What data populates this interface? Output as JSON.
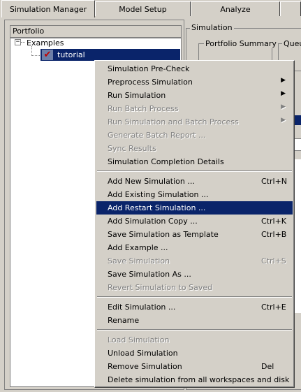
{
  "tabs": [
    {
      "label": "Simulation Manager",
      "active": true
    },
    {
      "label": "Model Setup",
      "active": false
    },
    {
      "label": "Analyze",
      "active": false
    }
  ],
  "left": {
    "group_title": "Portfolio",
    "tree": {
      "root_label": "Examples",
      "expander": "−",
      "selected_item": "tutorial"
    }
  },
  "right": {
    "group_title": "Simulation",
    "portfolio_summary_title": "Portfolio Summary",
    "queue_title": "Queu"
  },
  "context_menu": {
    "items": [
      {
        "label": "Simulation Pre-Check",
        "shortcut": "",
        "submenu": false,
        "enabled": true
      },
      {
        "label": "Preprocess Simulation",
        "shortcut": "",
        "submenu": true,
        "enabled": true
      },
      {
        "label": "Run Simulation",
        "shortcut": "",
        "submenu": true,
        "enabled": true
      },
      {
        "label": "Run Batch Process",
        "shortcut": "",
        "submenu": true,
        "enabled": false
      },
      {
        "label": "Run Simulation and Batch Process",
        "shortcut": "",
        "submenu": true,
        "enabled": false
      },
      {
        "label": "Generate Batch Report ...",
        "shortcut": "",
        "submenu": false,
        "enabled": false
      },
      {
        "label": "Sync Results",
        "shortcut": "",
        "submenu": false,
        "enabled": false
      },
      {
        "label": "Simulation Completion Details",
        "shortcut": "",
        "submenu": false,
        "enabled": true
      },
      {
        "label": "Add New Simulation ...",
        "shortcut": "Ctrl+N",
        "submenu": false,
        "enabled": true
      },
      {
        "label": "Add Existing Simulation ...",
        "shortcut": "",
        "submenu": false,
        "enabled": true
      },
      {
        "label": "Add Restart Simulation ...",
        "shortcut": "",
        "submenu": false,
        "enabled": true,
        "highlighted": true
      },
      {
        "label": "Add Simulation Copy ...",
        "shortcut": "Ctrl+K",
        "submenu": false,
        "enabled": true
      },
      {
        "label": "Save Simulation as Template",
        "shortcut": "Ctrl+B",
        "submenu": false,
        "enabled": true
      },
      {
        "label": "Add Example ...",
        "shortcut": "",
        "submenu": false,
        "enabled": true
      },
      {
        "label": "Save Simulation",
        "shortcut": "Ctrl+S",
        "submenu": false,
        "enabled": false
      },
      {
        "label": "Save Simulation As ...",
        "shortcut": "",
        "submenu": false,
        "enabled": true
      },
      {
        "label": "Revert Simulation to Saved",
        "shortcut": "",
        "submenu": false,
        "enabled": false
      },
      {
        "label": "Edit Simulation ...",
        "shortcut": "Ctrl+E",
        "submenu": false,
        "enabled": true
      },
      {
        "label": "Rename",
        "shortcut": "",
        "submenu": false,
        "enabled": true
      },
      {
        "label": "Load Simulation",
        "shortcut": "",
        "submenu": false,
        "enabled": false
      },
      {
        "label": "Unload Simulation",
        "shortcut": "",
        "submenu": false,
        "enabled": true
      },
      {
        "label": "Remove Simulation",
        "shortcut": "Del",
        "submenu": false,
        "enabled": true
      },
      {
        "label": "Delete simulation from all workspaces and disk",
        "shortcut": "",
        "submenu": false,
        "enabled": true
      }
    ]
  },
  "colors": {
    "window_bg": "#d4d0c8",
    "highlight": "#0a246a",
    "disabled_text": "#808080"
  }
}
